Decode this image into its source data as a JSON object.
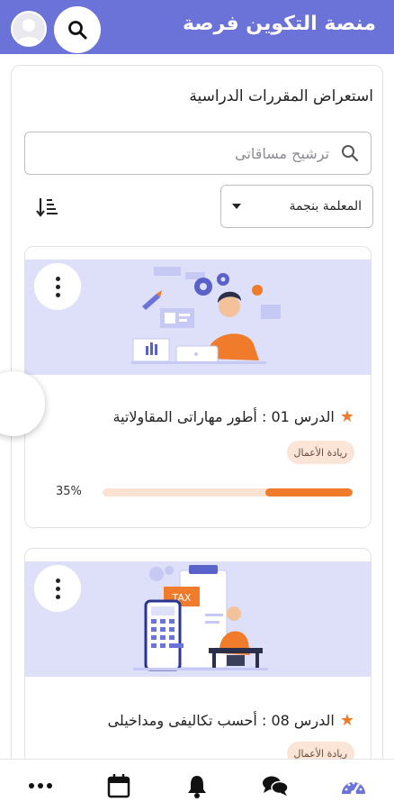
{
  "header": {
    "title": "منصة التكوين فرصة",
    "search_icon": "search-icon",
    "avatar_icon": "user-avatar-icon"
  },
  "main": {
    "heading": "استعراض المقررات الدراسية",
    "search": {
      "placeholder": "ترشيح مساقاتى",
      "value": ""
    },
    "filter": {
      "selected": "المعلمة بنجمة"
    },
    "sort_icon": "sort-descending-icon"
  },
  "courses": [
    {
      "title": "الدرس 01 : أطور مهاراتى المقاولاتية",
      "tag": "ريادة الأعمال",
      "progress_label": "35%",
      "progress_fraction": 0.35,
      "starred": true,
      "illustration_text": ""
    },
    {
      "title": "الدرس 08 : أحسب تكاليفى ومداخيلى",
      "tag": "ريادة الأعمال",
      "starred": true,
      "illustration_text": "TAX"
    }
  ],
  "bottom_nav": [
    "dashboard-icon",
    "chat-icon",
    "bell-icon",
    "calendar-icon",
    "more-icon"
  ],
  "colors": {
    "primary": "#6b72d8",
    "accent": "#f07b2b",
    "banner_bg": "#dde0f8",
    "tag_bg": "#fbe5d6"
  }
}
